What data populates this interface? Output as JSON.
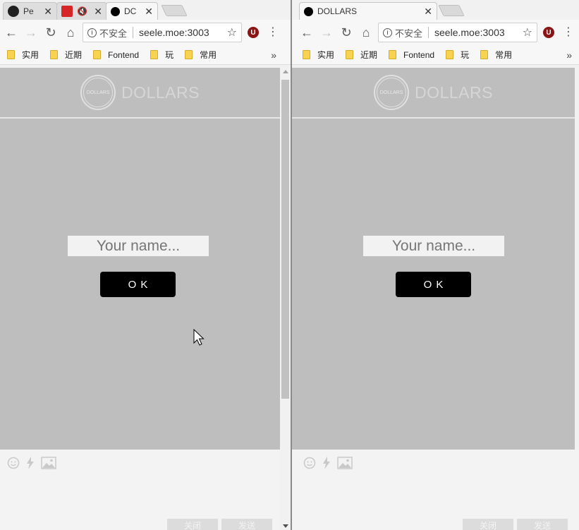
{
  "left": {
    "tabs": [
      {
        "title": "Pe",
        "icon": "github-icon",
        "active": false,
        "muted": false
      },
      {
        "title": "",
        "icon": "app-red-icon",
        "active": false,
        "muted": true
      },
      {
        "title": "DC",
        "icon": "dollars-dot-icon",
        "active": true,
        "muted": false
      }
    ],
    "omnibox": {
      "security": "不安全",
      "url": "seele.moe:3003"
    },
    "bookmarks": [
      "实用",
      "近期",
      "Fontend",
      "玩",
      "常用"
    ],
    "site": {
      "logo_inner": "DOLLARS",
      "logo_text": "DOLLARS"
    },
    "login": {
      "placeholder": "Your name...",
      "ok": "OK"
    },
    "chat": {
      "close": "关闭",
      "send": "发送"
    }
  },
  "right": {
    "tabs": [
      {
        "title": "DOLLARS",
        "icon": "dollars-dot-icon",
        "active": true,
        "muted": false
      }
    ],
    "omnibox": {
      "security": "不安全",
      "url": "seele.moe:3003"
    },
    "bookmarks": [
      "实用",
      "近期",
      "Fontend",
      "玩",
      "常用"
    ],
    "site": {
      "logo_inner": "DOLLARS",
      "logo_text": "DOLLARS"
    },
    "login": {
      "placeholder": "Your name...",
      "ok": "OK"
    },
    "chat": {
      "close": "关闭",
      "send": "发送"
    }
  },
  "colors": {
    "page_bg": "#bebebe",
    "button_bg": "#000000",
    "input_bg": "#f2f2f2",
    "extension": "#8b1414"
  }
}
